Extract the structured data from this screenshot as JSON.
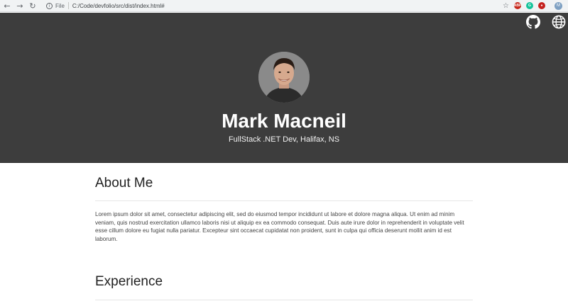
{
  "browser": {
    "file_label": "File",
    "url": "C:/Code/devfolio/src/dist/index.html#",
    "profile_initial": "M",
    "ext_abp": "ABP"
  },
  "hero": {
    "name": "Mark Macneil",
    "tagline": "FullStack .NET Dev, Halifax, NS"
  },
  "about": {
    "title": "About Me",
    "body": "Lorem ipsum dolor sit amet, consectetur adipiscing elit, sed do eiusmod tempor incididunt ut labore et dolore magna aliqua. Ut enim ad minim veniam, quis nostrud exercitation ullamco laboris nisi ut aliquip ex ea commodo consequat. Duis aute irure dolor in reprehenderit in voluptate velit esse cillum dolore eu fugiat nulla pariatur. Excepteur sint occaecat cupidatat non proident, sunt in culpa qui officia deserunt mollit anim id est laborum."
  },
  "experience": {
    "title": "Experience"
  },
  "colors": {
    "hero_bg": "#3d3d3d",
    "text": "#222222"
  }
}
